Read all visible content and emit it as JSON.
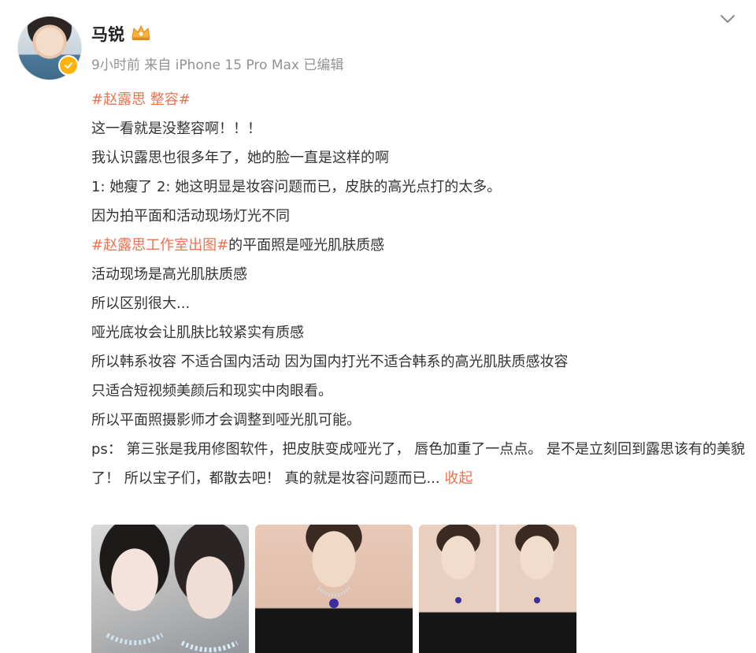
{
  "author": {
    "name": "马锐",
    "verified_badge": "orange-verified-check",
    "crown_icon": "crown-icon"
  },
  "meta": {
    "text": "9小时前 来自 iPhone 15 Pro Max 已编辑"
  },
  "post": {
    "hashtag_1": "#赵露思 整容#",
    "line_1": "这一看就是没整容啊！！！",
    "line_2": "我认识露思也很多年了，她的脸一直是这样的啊",
    "line_3": "1: 她瘦了   2: 她这明显是妆容问题而已，皮肤的高光点打的太多。",
    "line_4": "因为拍平面和活动现场灯光不同",
    "hashtag_2": "#赵露思工作室出图#",
    "line_5_rest": "的平面照是哑光肌肤质感",
    "line_6": "活动现场是高光肌肤质感",
    "line_7": "所以区别很大...",
    "line_8": "哑光底妆会让肌肤比较紧实有质感",
    "line_9": "所以韩系妆容 不适合国内活动 因为国内打光不适合韩系的高光肌肤质感妆容",
    "line_10": "只适合短视频美颜后和现实中肉眼看。",
    "line_11": "所以平面照摄影师才会调整到哑光肌可能。",
    "line_12": "ps： 第三张是我用修图软件，把皮肤变成哑光了， 唇色加重了一点点。 是不是立刻回到露思该有的美貌了！ 所以宝子们，都散去吧！ 真的就是妆容问题而已...",
    "collapse_label": "收起"
  },
  "colors": {
    "link": "#eb7350",
    "meta": "#939393",
    "text": "#333333",
    "badge": "#ffb30f"
  }
}
